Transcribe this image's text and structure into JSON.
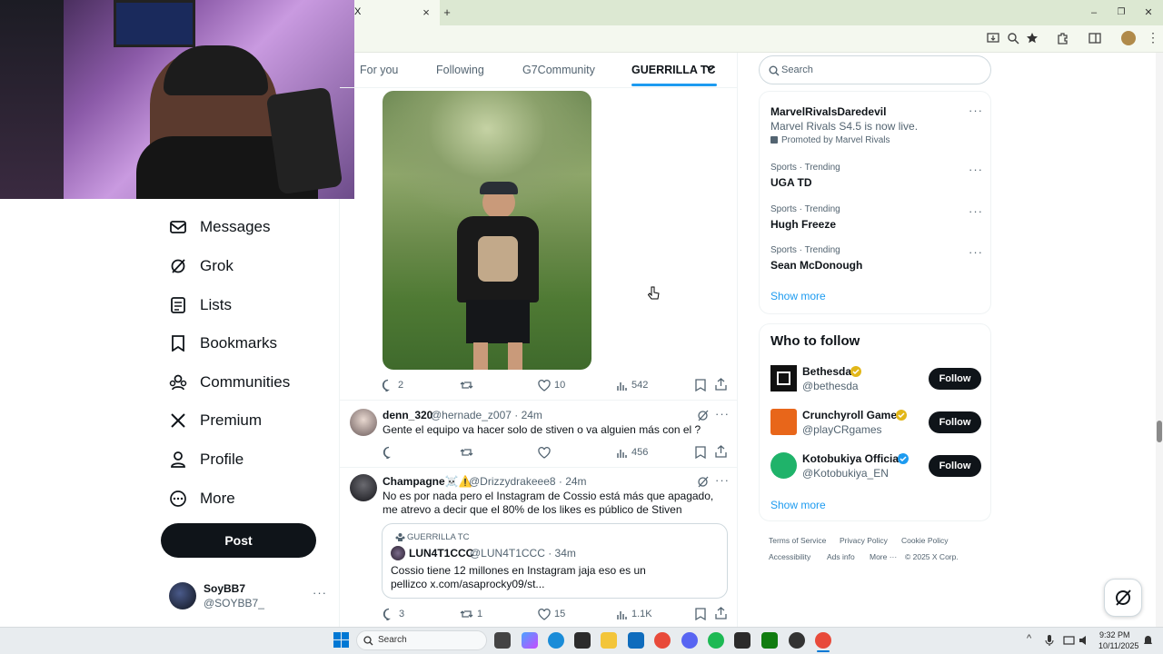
{
  "browser": {
    "tab_close": "×",
    "new_tab": "+",
    "tab_label": "X",
    "win_min": "–",
    "win_max": "❐",
    "win_close": "✕"
  },
  "nav": {
    "items": [
      {
        "label": "Messages",
        "icon": "mail-icon"
      },
      {
        "label": "Grok",
        "icon": "grok-icon"
      },
      {
        "label": "Lists",
        "icon": "list-icon"
      },
      {
        "label": "Bookmarks",
        "icon": "bookmark-icon"
      },
      {
        "label": "Communities",
        "icon": "communities-icon"
      },
      {
        "label": "Premium",
        "icon": "x-logo-icon"
      },
      {
        "label": "Profile",
        "icon": "person-icon"
      },
      {
        "label": "More",
        "icon": "more-circle-icon"
      }
    ],
    "post_label": "Post",
    "account": {
      "name": "SoyBB7",
      "handle": "@SOYBB7_"
    }
  },
  "feed": {
    "tabs": [
      "For you",
      "Following",
      "G7Community",
      "GUERRILLA TC"
    ],
    "post1_actions": {
      "replies": "2",
      "reposts": "",
      "likes": "10",
      "views": "542"
    },
    "tweets": [
      {
        "name": "denn_320",
        "meta": "@hernade_z007 · 24m",
        "text": "Gente el equipo va hacer solo de stiven o va alguien más con el ?",
        "replies": "",
        "reposts": "",
        "likes": "",
        "views": "456"
      },
      {
        "name": "Champagne☠️⚠️",
        "meta": "@Drizzydrakeee8 · 24m",
        "text": "No es por nada pero el Instagram de Cossio está más que apagado, me atrevo a decir que el 80% de los likes es público de Stiven",
        "quote": {
          "community": "GUERRILLA TC",
          "name": "LUN4T1CCC",
          "meta": "@LUN4T1CCC · 34m",
          "text": "Cossio tiene 12 millones en Instagram jaja eso es un pellizco x.com/asaprocky09/st..."
        },
        "replies": "3",
        "reposts": "1",
        "likes": "15",
        "views": "1.1K"
      }
    ]
  },
  "sidebar": {
    "search_placeholder": "Search",
    "promoted": {
      "title": "MarvelRivalsDaredevil",
      "text": "Marvel Rivals S4.5 is now live.",
      "promoted_by": "Promoted by Marvel Rivals"
    },
    "trends": [
      {
        "category": "Sports · Trending",
        "title": "UGA TD"
      },
      {
        "category": "Sports · Trending",
        "title": "Hugh Freeze"
      },
      {
        "category": "Sports · Trending",
        "title": "Sean McDonough"
      }
    ],
    "show_more": "Show more",
    "who_to_follow": {
      "heading": "Who to follow",
      "accounts": [
        {
          "name": "Bethesda",
          "handle": "@bethesda",
          "badge_color": "#e2b719"
        },
        {
          "name": "Crunchyroll Games",
          "handle": "@playCRgames",
          "badge_color": "#e2b719"
        },
        {
          "name": "Kotobukiya Official",
          "handle": "@Kotobukiya_EN",
          "badge_color": "#1d9bf0"
        }
      ],
      "follow_label": "Follow",
      "show_more": "Show more"
    },
    "footer": [
      "Terms of Service",
      "Privacy Policy",
      "Cookie Policy",
      "Accessibility",
      "Ads info",
      "More ···",
      "© 2025 X Corp."
    ]
  },
  "taskbar": {
    "search_placeholder": "Search",
    "time": "9:32 PM",
    "date": "10/11/2025"
  },
  "colors": {
    "accent": "#1d9bf0",
    "text": "#0f1419",
    "muted": "#536471"
  }
}
